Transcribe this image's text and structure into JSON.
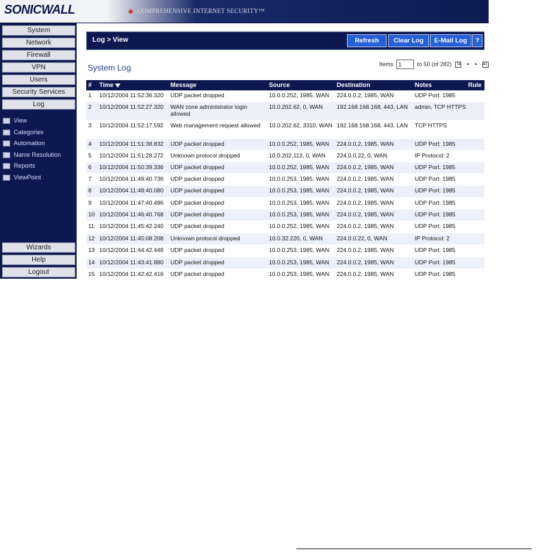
{
  "banner": {
    "logo": "SONICWALL",
    "tagline": "COMPREHENSIVE INTERNET SECURITY™"
  },
  "sidebar": {
    "top_items": [
      {
        "label": "System"
      },
      {
        "label": "Network"
      },
      {
        "label": "Firewall"
      },
      {
        "label": "VPN"
      },
      {
        "label": "Users"
      },
      {
        "label": "Security Services"
      },
      {
        "label": "Log"
      }
    ],
    "sub_items": [
      {
        "label": "View",
        "icon": "folder-open-icon"
      },
      {
        "label": "Categories",
        "icon": "folder-icon"
      },
      {
        "label": "Automation",
        "icon": "folder-icon"
      },
      {
        "label": "Name Resolution",
        "icon": "folder-icon"
      },
      {
        "label": "Reports",
        "icon": "folder-icon"
      },
      {
        "label": "ViewPoint",
        "icon": "folder-icon"
      }
    ],
    "bottom_items": [
      {
        "label": "Wizards"
      },
      {
        "label": "Help"
      },
      {
        "label": "Logout"
      }
    ]
  },
  "topbar": {
    "title": "Log > View",
    "buttons": [
      "Refresh",
      "Clear Log",
      "E-Mail Log",
      "?"
    ]
  },
  "log": {
    "title": "System Log",
    "pager": {
      "items_label": "Items",
      "value": "1",
      "range": "to 50 (of 282)"
    },
    "columns": [
      "#",
      "Time",
      "Message",
      "Source",
      "Destination",
      "Notes",
      "Rule"
    ],
    "rows": [
      {
        "num": "1",
        "time": "10/12/2004 11:52:36.320",
        "message": "UDP packet dropped",
        "source": "10.0.0.252, 1985, WAN",
        "destination": "224.0.0.2, 1985, WAN",
        "notes": "UDP Port: 1985",
        "rule": ""
      },
      {
        "num": "2",
        "time": "10/12/2004 11:52:27.320",
        "message": "WAN zone administrator login allowed",
        "source": "10.0.202.62, 0, WAN",
        "destination": "192.168.168.168, 443, LAN",
        "notes": "admin, TCP HTTPS",
        "rule": ""
      },
      {
        "num": "3",
        "time": "10/12/2004 11:52:17.592",
        "message": "Web management request allowed",
        "source": "10.0.202.62, 3310, WAN",
        "destination": "192.168.168.168, 443, LAN",
        "notes": "TCP HTTPS",
        "rule": ""
      },
      {
        "num": "4",
        "time": "10/12/2004 11:51:38.832",
        "message": "UDP packet dropped",
        "source": "10.0.0.252, 1985, WAN",
        "destination": "224.0.0.2, 1985, WAN",
        "notes": "UDP Port: 1985",
        "rule": ""
      },
      {
        "num": "5",
        "time": "10/12/2004 11:51:28.272",
        "message": "Unknown protocol dropped",
        "source": "10.0.202.113, 0, WAN",
        "destination": "224.0.0.22, 0, WAN",
        "notes": "IP Protocol: 2",
        "rule": ""
      },
      {
        "num": "6",
        "time": "10/12/2004 11:50:39.336",
        "message": "UDP packet dropped",
        "source": "10.0.0.252, 1985, WAN",
        "destination": "224.0.0.2, 1985, WAN",
        "notes": "UDP Port: 1985",
        "rule": ""
      },
      {
        "num": "7",
        "time": "10/12/2004 11:49:40.736",
        "message": "UDP packet dropped",
        "source": "10.0.0.253, 1985, WAN",
        "destination": "224.0.0.2, 1985, WAN",
        "notes": "UDP Port: 1985",
        "rule": ""
      },
      {
        "num": "8",
        "time": "10/12/2004 11:48:40.080",
        "message": "UDP packet dropped",
        "source": "10.0.0.253, 1985, WAN",
        "destination": "224.0.0.2, 1985, WAN",
        "notes": "UDP Port: 1985",
        "rule": ""
      },
      {
        "num": "9",
        "time": "10/12/2004 11:47:40.496",
        "message": "UDP packet dropped",
        "source": "10.0.0.253, 1985, WAN",
        "destination": "224.0.0.2, 1985, WAN",
        "notes": "UDP Port: 1985",
        "rule": ""
      },
      {
        "num": "10",
        "time": "10/12/2004 11:46:40.768",
        "message": "UDP packet dropped",
        "source": "10.0.0.253, 1985, WAN",
        "destination": "224.0.0.2, 1985, WAN",
        "notes": "UDP Port: 1985",
        "rule": ""
      },
      {
        "num": "11",
        "time": "10/12/2004 11:45:42.240",
        "message": "UDP packet dropped",
        "source": "10.0.0.252, 1985, WAN",
        "destination": "224.0.0.2, 1985, WAN",
        "notes": "UDP Port: 1985",
        "rule": ""
      },
      {
        "num": "12",
        "time": "10/12/2004 11:45:08.208",
        "message": "Unknown protocol dropped",
        "source": "10.0.32.220, 0, WAN",
        "destination": "224.0.0.22, 0, WAN",
        "notes": "IP Protocol: 2",
        "rule": ""
      },
      {
        "num": "13",
        "time": "10/12/2004 11:44:42.448",
        "message": "UDP packet dropped",
        "source": "10.0.0.253, 1985, WAN",
        "destination": "224.0.0.2, 1985, WAN",
        "notes": "UDP Port: 1985",
        "rule": ""
      },
      {
        "num": "14",
        "time": "10/12/2004 11:43:41.880",
        "message": "UDP packet dropped",
        "source": "10.0.0.253, 1985, WAN",
        "destination": "224.0.0.2, 1985, WAN",
        "notes": "UDP Port: 1985",
        "rule": ""
      },
      {
        "num": "15",
        "time": "10/12/2004 11:42:42.416",
        "message": "UDP packet dropped",
        "source": "10.0.0.253, 1985, WAN",
        "destination": "224.0.0.2, 1985, WAN",
        "notes": "UDP Port: 1985",
        "rule": ""
      }
    ]
  }
}
